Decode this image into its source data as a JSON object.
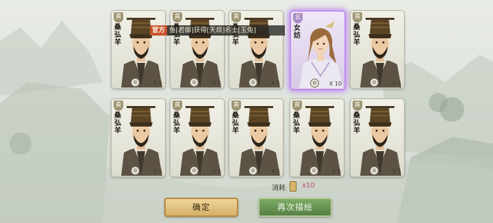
{
  "banner": {
    "tag": "官方",
    "text": "鱼[君御]获得[天烦]名士[玉兔]"
  },
  "cards": [
    {
      "rank": "黄",
      "name": "桑弘羊",
      "count": "X 5",
      "legendary": false
    },
    {
      "rank": "黄",
      "name": "桑弘羊",
      "count": "X 5",
      "legendary": false
    },
    {
      "rank": "黄",
      "name": "桑弘羊",
      "count": "X 5",
      "legendary": false
    },
    {
      "rank": "玄",
      "name": "女妨",
      "count": "X 10",
      "legendary": true
    },
    {
      "rank": "黄",
      "name": "桑弘羊",
      "count": "X 5",
      "legendary": false
    },
    {
      "rank": "黄",
      "name": "桑弘羊",
      "count": "X 5",
      "legendary": false
    },
    {
      "rank": "黄",
      "name": "桑弘羊",
      "count": "X 5",
      "legendary": false
    },
    {
      "rank": "黄",
      "name": "桑弘羊",
      "count": "X 5",
      "legendary": false
    },
    {
      "rank": "黄",
      "name": "桑弘羊",
      "count": "X 5",
      "legendary": false
    },
    {
      "rank": "黄",
      "name": "桑弘羊",
      "count": "X 5",
      "legendary": false
    }
  ],
  "cost": {
    "label": "消耗",
    "value": "x10"
  },
  "buttons": {
    "confirm": "确定",
    "again": "再次描绘"
  },
  "colors": {
    "legendary_glow": "#c08df0",
    "confirm": "#d6b06a",
    "again": "#567f44"
  }
}
